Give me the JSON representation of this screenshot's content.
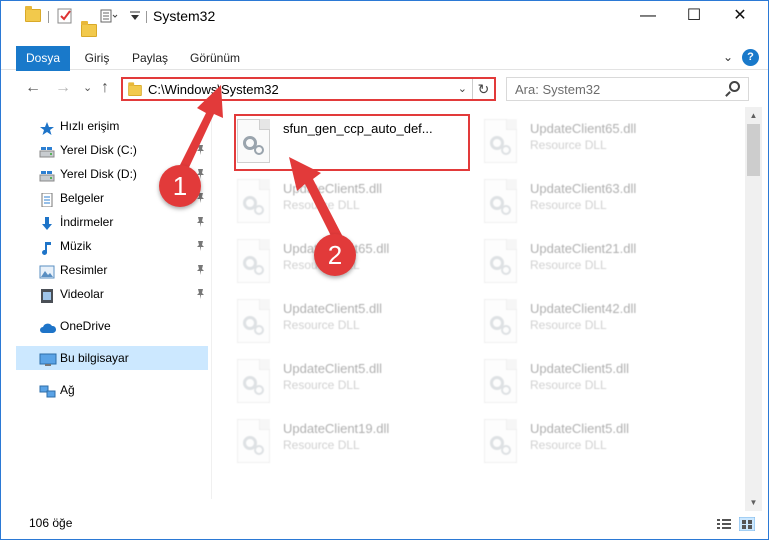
{
  "window": {
    "title": "System32",
    "controls": {
      "minimize": "—",
      "maximize": "☐",
      "close": "✕"
    }
  },
  "ribbon": {
    "tabs": [
      "Dosya",
      "Giriş",
      "Paylaş",
      "Görünüm"
    ],
    "expand": "⌄",
    "help": "?"
  },
  "nav": {
    "back": "←",
    "forward": "→",
    "recent": "⌄",
    "up": "↑",
    "address": "C:\\Windows\\System32",
    "address_dropdown": "⌄",
    "refresh": "↻",
    "search_placeholder": "Ara: System32"
  },
  "sidebar": {
    "items": [
      {
        "label": "Hızlı erişim",
        "icon": "star-icon",
        "pinned": false,
        "selected": false
      },
      {
        "label": "Yerel Disk (C:)",
        "icon": "drive-icon",
        "pinned": true,
        "selected": false
      },
      {
        "label": "Yerel Disk (D:)",
        "icon": "drive-icon",
        "pinned": true,
        "selected": false
      },
      {
        "label": "Belgeler",
        "icon": "documents-icon",
        "pinned": true,
        "selected": false
      },
      {
        "label": "İndirmeler",
        "icon": "download-icon",
        "pinned": true,
        "selected": false
      },
      {
        "label": "Müzik",
        "icon": "music-icon",
        "pinned": true,
        "selected": false
      },
      {
        "label": "Resimler",
        "icon": "pictures-icon",
        "pinned": true,
        "selected": false
      },
      {
        "label": "Videolar",
        "icon": "videos-icon",
        "pinned": true,
        "selected": false
      },
      {
        "label": "OneDrive",
        "icon": "cloud-icon",
        "pinned": false,
        "selected": false
      },
      {
        "label": "Bu bilgisayar",
        "icon": "computer-icon",
        "pinned": false,
        "selected": true
      },
      {
        "label": "Ağ",
        "icon": "network-icon",
        "pinned": false,
        "selected": false
      }
    ],
    "pin_glyph": "📌"
  },
  "files": [
    {
      "name": "sfun_gen_ccp_auto_def...",
      "type": "",
      "highlighted": true
    },
    {
      "name": "UpdateClient65.dll",
      "type": "Resource DLL",
      "highlighted": false
    },
    {
      "name": "UpdateClient5.dll",
      "type": "Resource DLL",
      "highlighted": false
    },
    {
      "name": "UpdateClient63.dll",
      "type": "Resource DLL",
      "highlighted": false
    },
    {
      "name": "UpdateClient65.dll",
      "type": "Resource DLL",
      "highlighted": false
    },
    {
      "name": "UpdateClient21.dll",
      "type": "Resource DLL",
      "highlighted": false
    },
    {
      "name": "UpdateClient5.dll",
      "type": "Resource DLL",
      "highlighted": false
    },
    {
      "name": "UpdateClient42.dll",
      "type": "Resource DLL",
      "highlighted": false
    },
    {
      "name": "UpdateClient5.dll",
      "type": "Resource DLL",
      "highlighted": false
    },
    {
      "name": "UpdateClient5.dll",
      "type": "Resource DLL",
      "highlighted": false
    },
    {
      "name": "UpdateClient19.dll",
      "type": "Resource DLL",
      "highlighted": false
    },
    {
      "name": "UpdateClient5.dll",
      "type": "Resource DLL",
      "highlighted": false
    }
  ],
  "status": {
    "item_count": "106 öğe"
  },
  "annotations": {
    "step1": "1",
    "step2": "2",
    "color": "#e23a3a"
  },
  "colors": {
    "accent": "#1979ca",
    "selection": "#cce8ff",
    "annotation": "#e23a3a"
  }
}
